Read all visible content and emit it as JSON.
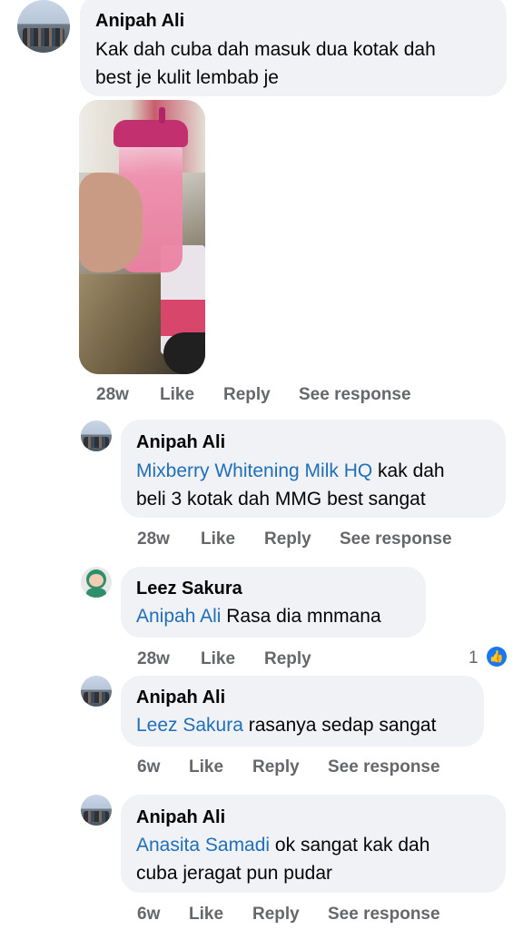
{
  "comments": [
    {
      "name": "Anipah Ali",
      "text_line1": "Kak dah cuba dah masuk dua kotak dah",
      "text_line2": "best je kulit lembab je",
      "time": "28w",
      "like": "Like",
      "reply": "Reply",
      "see": "See response"
    },
    {
      "name": "Anipah Ali",
      "mention": "Mixberry Whitening Milk HQ",
      "text_line1_rest": " kak dah",
      "text_line2": "beli 3 kotak dah MMG best sangat",
      "time": "28w",
      "like": "Like",
      "reply": "Reply",
      "see": "See response"
    },
    {
      "name": "Leez Sakura",
      "mention": "Anipah Ali",
      "text_rest": " Rasa dia mnmana",
      "time": "28w",
      "like": "Like",
      "reply": "Reply",
      "reaction_count": "1"
    },
    {
      "name": "Anipah Ali",
      "mention": "Leez Sakura",
      "text_rest": " rasanya sedap sangat",
      "time": "6w",
      "like": "Like",
      "reply": "Reply",
      "see": "See response"
    },
    {
      "name": "Anipah Ali",
      "mention": "Anasita Samadi",
      "text_line1_rest": " ok sangat kak dah",
      "text_line2": "cuba jeragat pun pudar",
      "time": "6w",
      "like": "Like",
      "reply": "Reply",
      "see": "See response"
    }
  ],
  "icons": {
    "like_reaction": "thumbs-up-icon"
  },
  "colors": {
    "bubble": "#f0f2f5",
    "mention": "#1f6fb9",
    "meta": "#65676b",
    "like_blue": "#1877f2"
  }
}
